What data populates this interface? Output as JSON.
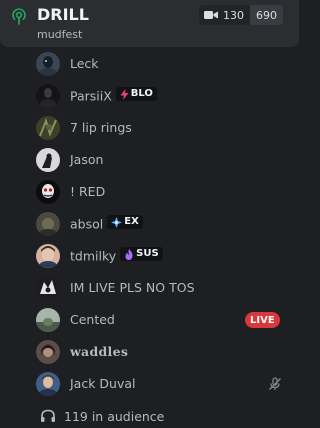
{
  "channel": {
    "name": "DRILL",
    "subtitle": "mudfest",
    "stream_count": "130",
    "total_count": "690"
  },
  "members": [
    {
      "name": "Leck",
      "avatar": "avatar-leck"
    },
    {
      "name": "ParsiiX",
      "tag": "BLO",
      "tag_icon": "lightning-icon",
      "tag_color": "#f23f7a"
    },
    {
      "name": "7 lip rings"
    },
    {
      "name": "Jason"
    },
    {
      "name": "! RED"
    },
    {
      "name": "absol",
      "tag": "EX",
      "tag_icon": "diamond-cross-icon",
      "tag_color": "#5ab0ff"
    },
    {
      "name": "tdmilky",
      "tag": "SUS",
      "tag_icon": "flame-icon",
      "tag_color": "#a56cf7"
    },
    {
      "name": "IM LIVE PLS NO TOS"
    },
    {
      "name": "Cented",
      "badge": "LIVE"
    },
    {
      "name": "waddles"
    },
    {
      "name": "Jack Duval",
      "status_icon": "mic-muted-icon"
    }
  ],
  "audience": {
    "label": "119 in audience",
    "icon": "headphones-icon"
  },
  "colors": {
    "accent_green": "#23a55a",
    "live_red": "#da373c",
    "background": "#1e1f22",
    "header_bg": "#2b2d31"
  }
}
